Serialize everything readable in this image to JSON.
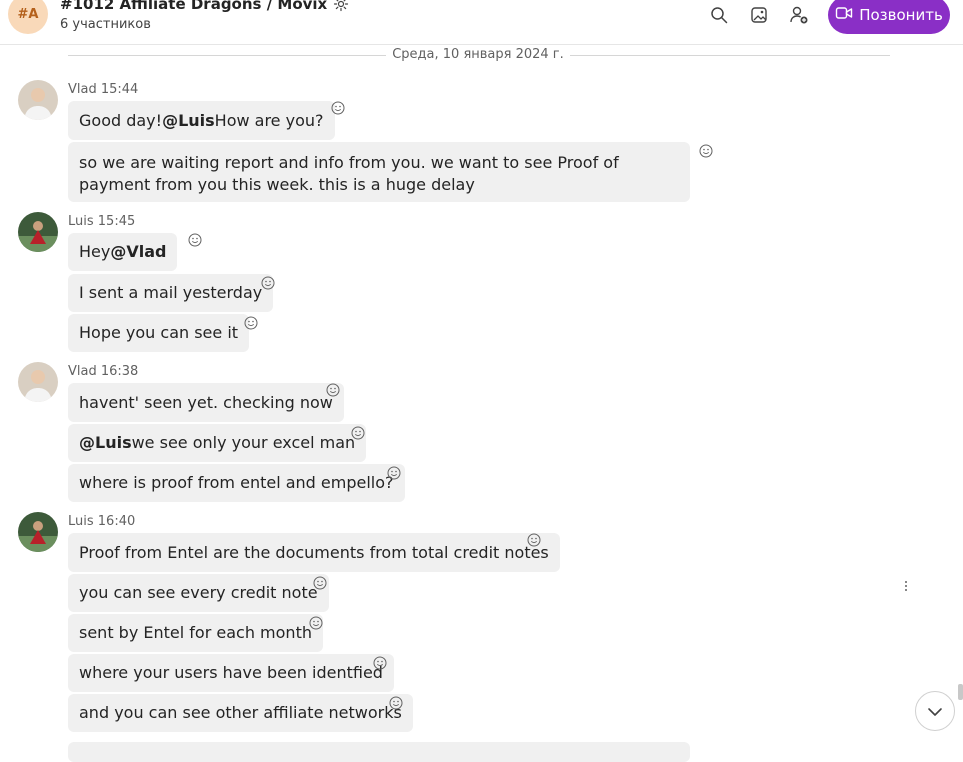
{
  "header": {
    "avatar_initials": "#A",
    "title": "#1012 Affiliate Dragons / Movix",
    "subtitle": "6 участников",
    "call_label": "Позвонить",
    "icons": [
      "search-icon",
      "gallery-icon",
      "add-person-icon",
      "video-call-icon",
      "gear-icon"
    ],
    "accent_color": "#8a2fc6"
  },
  "date_divider": "Среда, 10 января 2024 г.",
  "messages": [
    {
      "meta": "Vlad 15:44",
      "texts": [
        "Good day! ",
        "@Luis",
        " How are you?"
      ]
    },
    {
      "text": "so we are waiting report and info from you. we want to see Proof of payment from you this week. this is a huge delay"
    },
    {
      "meta": "Luis 15:45",
      "texts": [
        "Hey ",
        "@Vlad"
      ]
    },
    {
      "text": "I sent a mail yesterday"
    },
    {
      "text": "Hope you can see it"
    },
    {
      "meta": "Vlad 16:38",
      "text": "havent' seen yet. checking now"
    },
    {
      "texts": [
        "@Luis",
        " we see only your excel man"
      ]
    },
    {
      "text": "where is proof from entel and empello?"
    },
    {
      "meta": "Luis 16:40",
      "text": "Proof from Entel are the documents from total credit notes"
    },
    {
      "text": "you can see every credit note"
    },
    {
      "text": "sent by Entel for each month"
    },
    {
      "text": "where your users have been identfied"
    },
    {
      "text": "and you can see other affiliate networks"
    }
  ]
}
